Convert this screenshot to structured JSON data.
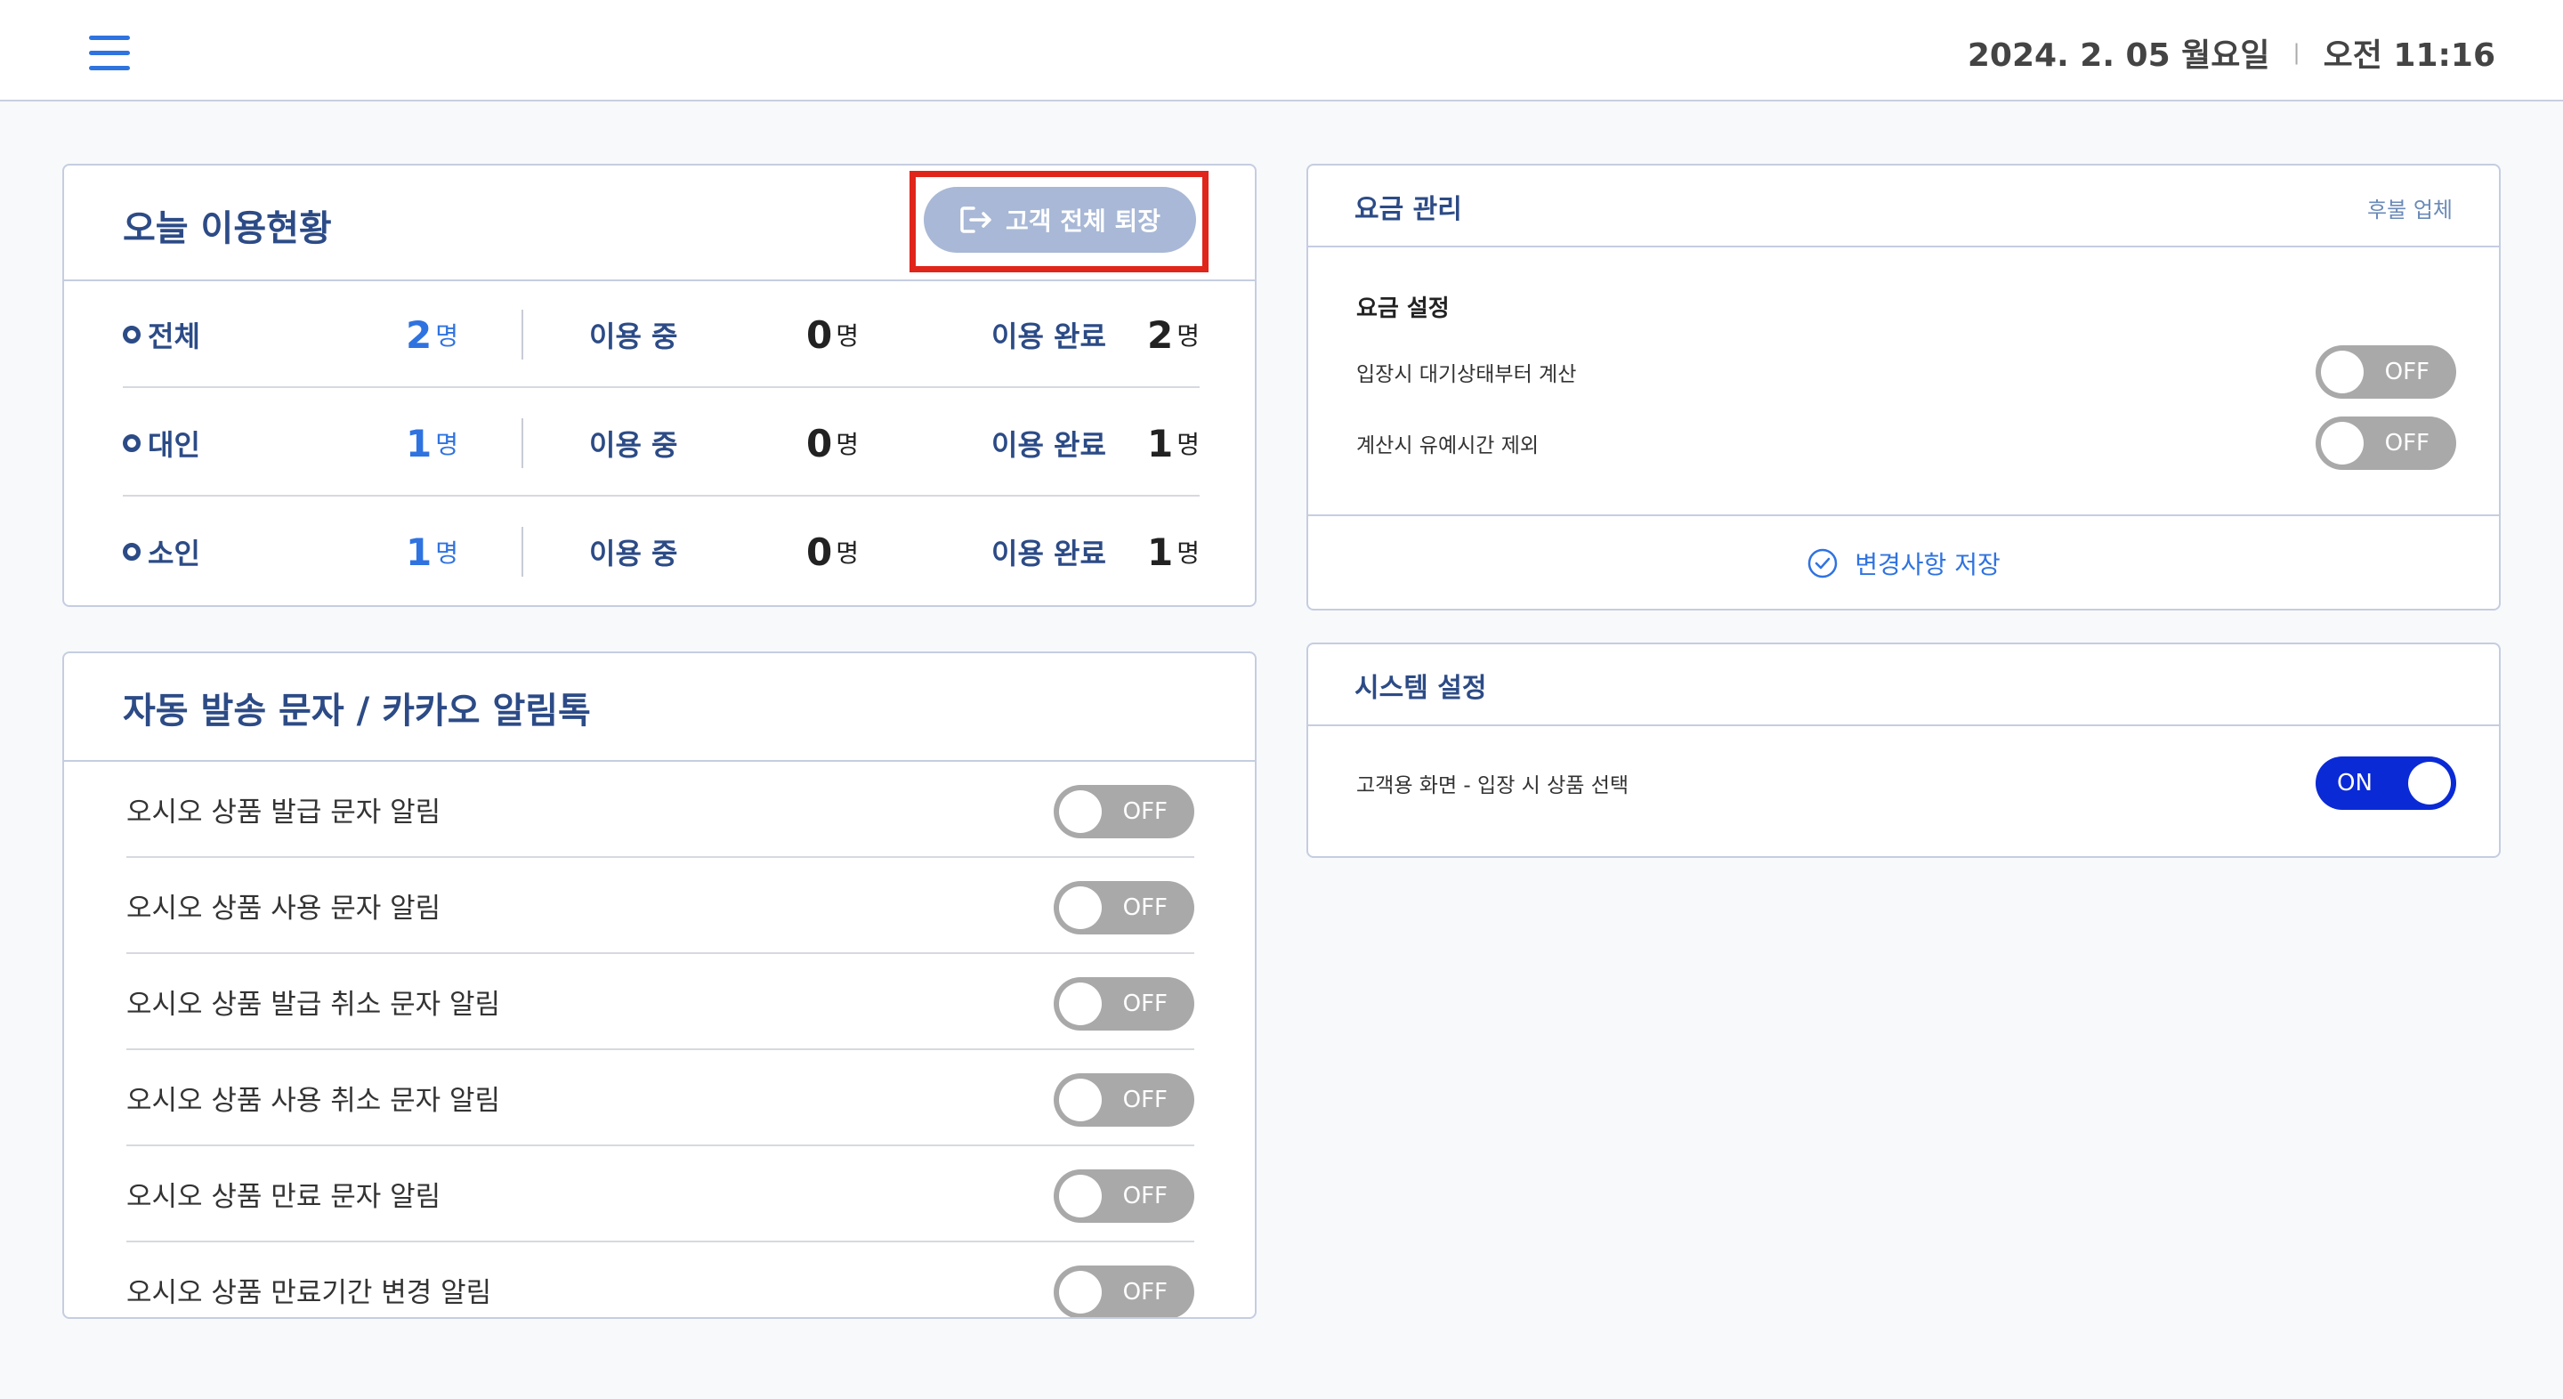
{
  "header": {
    "date": "2024. 2. 05 월요일",
    "separator": "|",
    "time": "오전 11:16"
  },
  "usage": {
    "title": "오늘 이용현황",
    "exit_button": "고객 전체 퇴장",
    "in_use_label": "이용 중",
    "done_label": "이용 완료",
    "unit": "명",
    "rows": [
      {
        "category": "전체",
        "total": "2",
        "in_use": "0",
        "done": "2"
      },
      {
        "category": "대인",
        "total": "1",
        "in_use": "0",
        "done": "1"
      },
      {
        "category": "소인",
        "total": "1",
        "in_use": "0",
        "done": "1"
      }
    ]
  },
  "notify": {
    "title": "자동 발송 문자 / 카카오 알림톡",
    "items": [
      {
        "label": "오시오 상품 발급 문자 알림",
        "state": "OFF"
      },
      {
        "label": "오시오 상품 사용 문자 알림",
        "state": "OFF"
      },
      {
        "label": "오시오 상품 발급 취소 문자 알림",
        "state": "OFF"
      },
      {
        "label": "오시오 상품 사용 취소 문자 알림",
        "state": "OFF"
      },
      {
        "label": "오시오 상품 만료 문자 알림",
        "state": "OFF"
      },
      {
        "label": "오시오 상품 만료기간 변경 알림",
        "state": "OFF"
      }
    ]
  },
  "fee": {
    "title": "요금 관리",
    "subtitle": "후불 업체",
    "section_title": "요금 설정",
    "items": [
      {
        "label": "입장시 대기상태부터 계산",
        "state": "OFF"
      },
      {
        "label": "계산시 유예시간 제외",
        "state": "OFF"
      }
    ],
    "save_label": "변경사항 저장"
  },
  "system": {
    "title": "시스템 설정",
    "items": [
      {
        "label": "고객용 화면 - 입장 시 상품 선택",
        "state": "ON"
      }
    ]
  },
  "colors": {
    "accent": "#2f73e0",
    "title": "#2c4b86",
    "toggle_off": "#a9a9a9",
    "toggle_on": "#0a2ad6",
    "highlight": "#e0251b"
  }
}
